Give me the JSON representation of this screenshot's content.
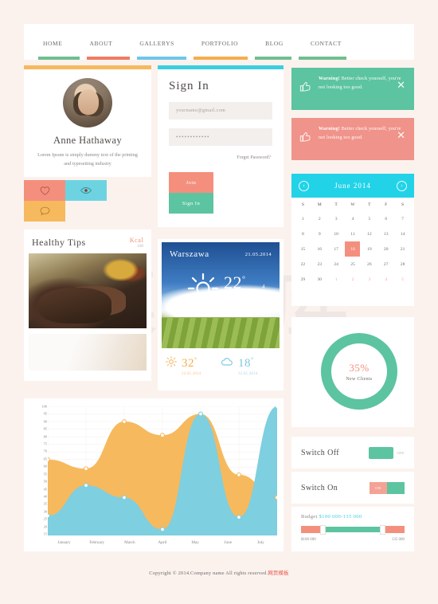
{
  "nav": {
    "items": [
      {
        "label": "HOME",
        "color": "#6fbf8e"
      },
      {
        "label": "ABOUT",
        "color": "#f07c63"
      },
      {
        "label": "GALLERYS",
        "color": "#6ec6e8"
      },
      {
        "label": "PORTFOLIO",
        "color": "#f6ad4e"
      },
      {
        "label": "BLOG",
        "color": "#6fbf8e"
      },
      {
        "label": "CONTACT",
        "color": "#6fbf8e"
      }
    ]
  },
  "profile": {
    "topbar_color": "#f6b95e",
    "name": "Anne Hathaway",
    "bio": "Lorem Ipsum is simply dummy text of the printing and typesetting industry",
    "actions": [
      {
        "name": "like",
        "icon": "heart-icon",
        "color": "#f48f7e"
      },
      {
        "name": "view",
        "icon": "eye-icon",
        "color": "#6ed3e0"
      },
      {
        "name": "comment",
        "icon": "comment-icon",
        "color": "#f6b95e"
      }
    ]
  },
  "signin": {
    "topbar_color": "#3ccfe0",
    "title": "Sign In",
    "email_value": "yourname@gmail.com",
    "password_value": "••••••••••••",
    "forgot_label": "Forget Password?",
    "join_label": "Join",
    "signin_label": "Sign In",
    "join_color": "#f48f7e",
    "signin_color": "#5cc4a0"
  },
  "alerts": [
    {
      "strong": "Warning!",
      "message": "Better check yourself, you're not looking too good.",
      "bg": "#5cc4a0",
      "close": "✕"
    },
    {
      "strong": "Warning!",
      "message": "Better check yourself, you're not looking too good.",
      "bg": "#f0938a",
      "close": "✕"
    }
  ],
  "calendar": {
    "header_color": "#22d3e8",
    "title": "June 2014",
    "prev": "‹",
    "next": "›",
    "weekdays": [
      "S",
      "M",
      "T",
      "W",
      "T",
      "F",
      "S"
    ],
    "weeks": [
      [
        {
          "d": "1"
        },
        {
          "d": "2"
        },
        {
          "d": "3"
        },
        {
          "d": "4"
        },
        {
          "d": "5"
        },
        {
          "d": "6"
        },
        {
          "d": "7"
        }
      ],
      [
        {
          "d": "8"
        },
        {
          "d": "9"
        },
        {
          "d": "10"
        },
        {
          "d": "11"
        },
        {
          "d": "12"
        },
        {
          "d": "13"
        },
        {
          "d": "14"
        }
      ],
      [
        {
          "d": "15"
        },
        {
          "d": "16"
        },
        {
          "d": "17"
        },
        {
          "d": "18",
          "sel": true
        },
        {
          "d": "19"
        },
        {
          "d": "20"
        },
        {
          "d": "21"
        }
      ],
      [
        {
          "d": "22"
        },
        {
          "d": "23"
        },
        {
          "d": "24"
        },
        {
          "d": "25"
        },
        {
          "d": "26"
        },
        {
          "d": "27"
        },
        {
          "d": "28"
        }
      ],
      [
        {
          "d": "29"
        },
        {
          "d": "30"
        },
        {
          "d": "1",
          "muted": true
        },
        {
          "d": "2",
          "muted": true
        },
        {
          "d": "3",
          "muted": true
        },
        {
          "d": "4",
          "muted": true
        },
        {
          "d": "5",
          "muted": true
        }
      ]
    ],
    "selected_color": "#f48f7e"
  },
  "healthy": {
    "title": "Healthy Tips",
    "kcal_label": "Kcal",
    "kcal_value": "230",
    "kcal_color": "#f48f7e"
  },
  "weather": {
    "city": "Warszawa",
    "date": "21.05.2014",
    "temp": "22",
    "temp_unit": "°",
    "wind": "4",
    "forecast": [
      {
        "icon": "sun-icon",
        "temp": "32",
        "unit": "°",
        "date": "22.05.2014",
        "color": "#f6ad4e"
      },
      {
        "icon": "cloud-icon",
        "temp": "18",
        "unit": "°",
        "date": "22.05.2014",
        "color": "#7ec9e0"
      }
    ]
  },
  "donut": {
    "percent": "35%",
    "label": "New Clients",
    "value": 35,
    "ring_color": "#5cc4a0",
    "text_color": "#f48f7e"
  },
  "switches": [
    {
      "label": "Switch Off",
      "state": "OFF",
      "on": false
    },
    {
      "label": "Switch On",
      "state": "ON",
      "on": true
    }
  ],
  "budget": {
    "label": "Budget",
    "range": "$100 000-135 000",
    "min_label": "$100 000",
    "max_label": "135 000",
    "accent": "#3ccfe0"
  },
  "footer": {
    "text": "Copyright © 2014.Company name All rights reserved.",
    "watermark": "网页模板"
  },
  "chart_data": {
    "type": "area",
    "title": "",
    "xlabel": "",
    "ylabel": "",
    "categories": [
      "January",
      "February",
      "March",
      "April",
      "May",
      "June",
      "July"
    ],
    "ylim": [
      15,
      100
    ],
    "yticks": [
      100,
      95,
      90,
      85,
      80,
      75,
      70,
      65,
      60,
      55,
      50,
      45,
      40,
      35,
      30,
      25,
      20,
      15
    ],
    "grid": true,
    "legend": "none",
    "series": [
      {
        "name": "Orange",
        "color": "#f6b95e",
        "values": [
          65,
          59,
          90,
          81,
          95,
          55,
          40
        ]
      },
      {
        "name": "Blue",
        "color": "#7ecfe0",
        "values": [
          28,
          48,
          40,
          19,
          95,
          27,
          100
        ]
      }
    ]
  }
}
